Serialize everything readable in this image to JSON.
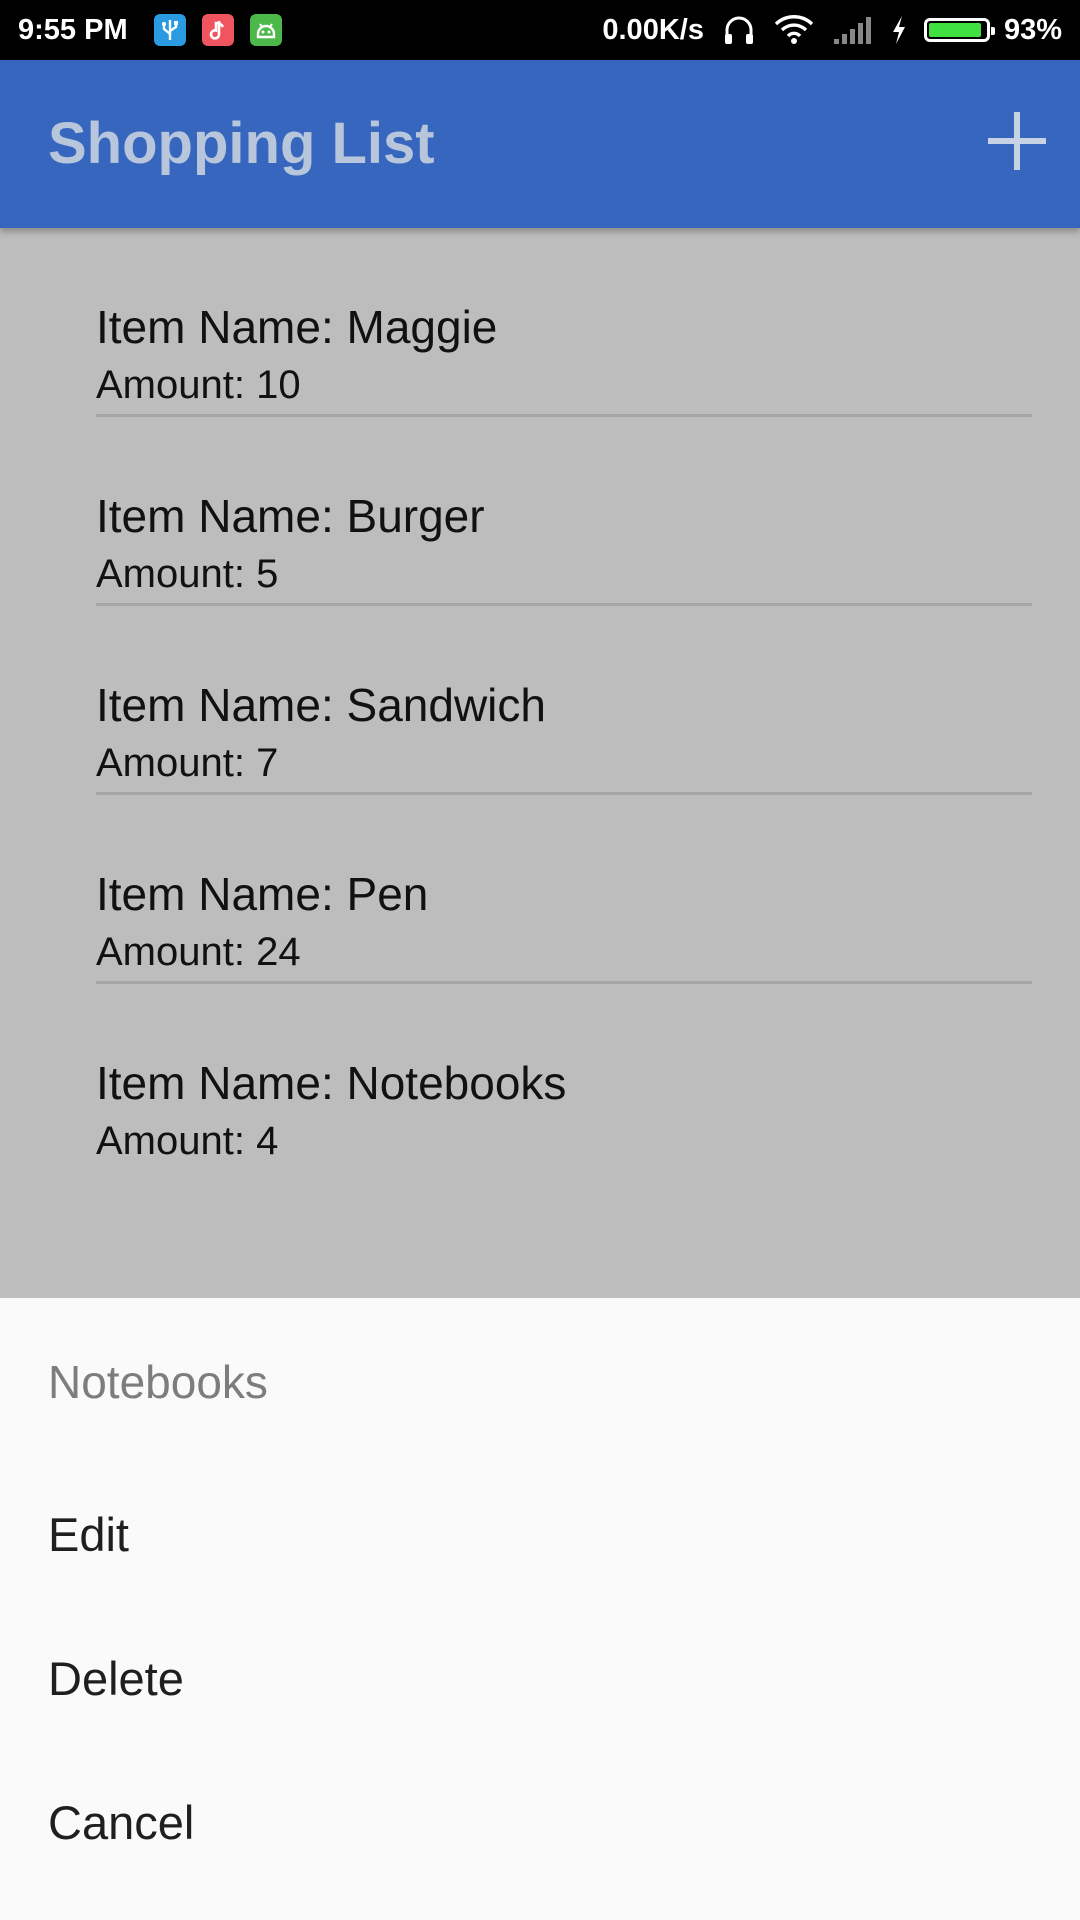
{
  "status_bar": {
    "time": "9:55 PM",
    "network_speed": "0.00K/s",
    "battery_percent": "93%",
    "battery_level": 0.93,
    "notification_icons": [
      "usb-icon",
      "music-icon",
      "android-icon"
    ],
    "status_icons": [
      "headphones-icon",
      "wifi-icon",
      "signal-icon",
      "charging-icon",
      "battery-icon"
    ]
  },
  "app_bar": {
    "title": "Shopping List",
    "add_icon": "plus-icon",
    "background": "#3766be"
  },
  "items": [
    {
      "name": "Item Name: Maggie",
      "amount": "Amount: 10"
    },
    {
      "name": "Item Name: Burger",
      "amount": "Amount: 5"
    },
    {
      "name": "Item Name: Sandwich",
      "amount": "Amount: 7"
    },
    {
      "name": "Item Name: Pen",
      "amount": "Amount: 24"
    },
    {
      "name": "Item Name: Notebooks",
      "amount": "Amount: 4"
    }
  ],
  "context_sheet": {
    "title": "Notebooks",
    "options": {
      "edit": "Edit",
      "delete": "Delete",
      "cancel": "Cancel"
    }
  }
}
